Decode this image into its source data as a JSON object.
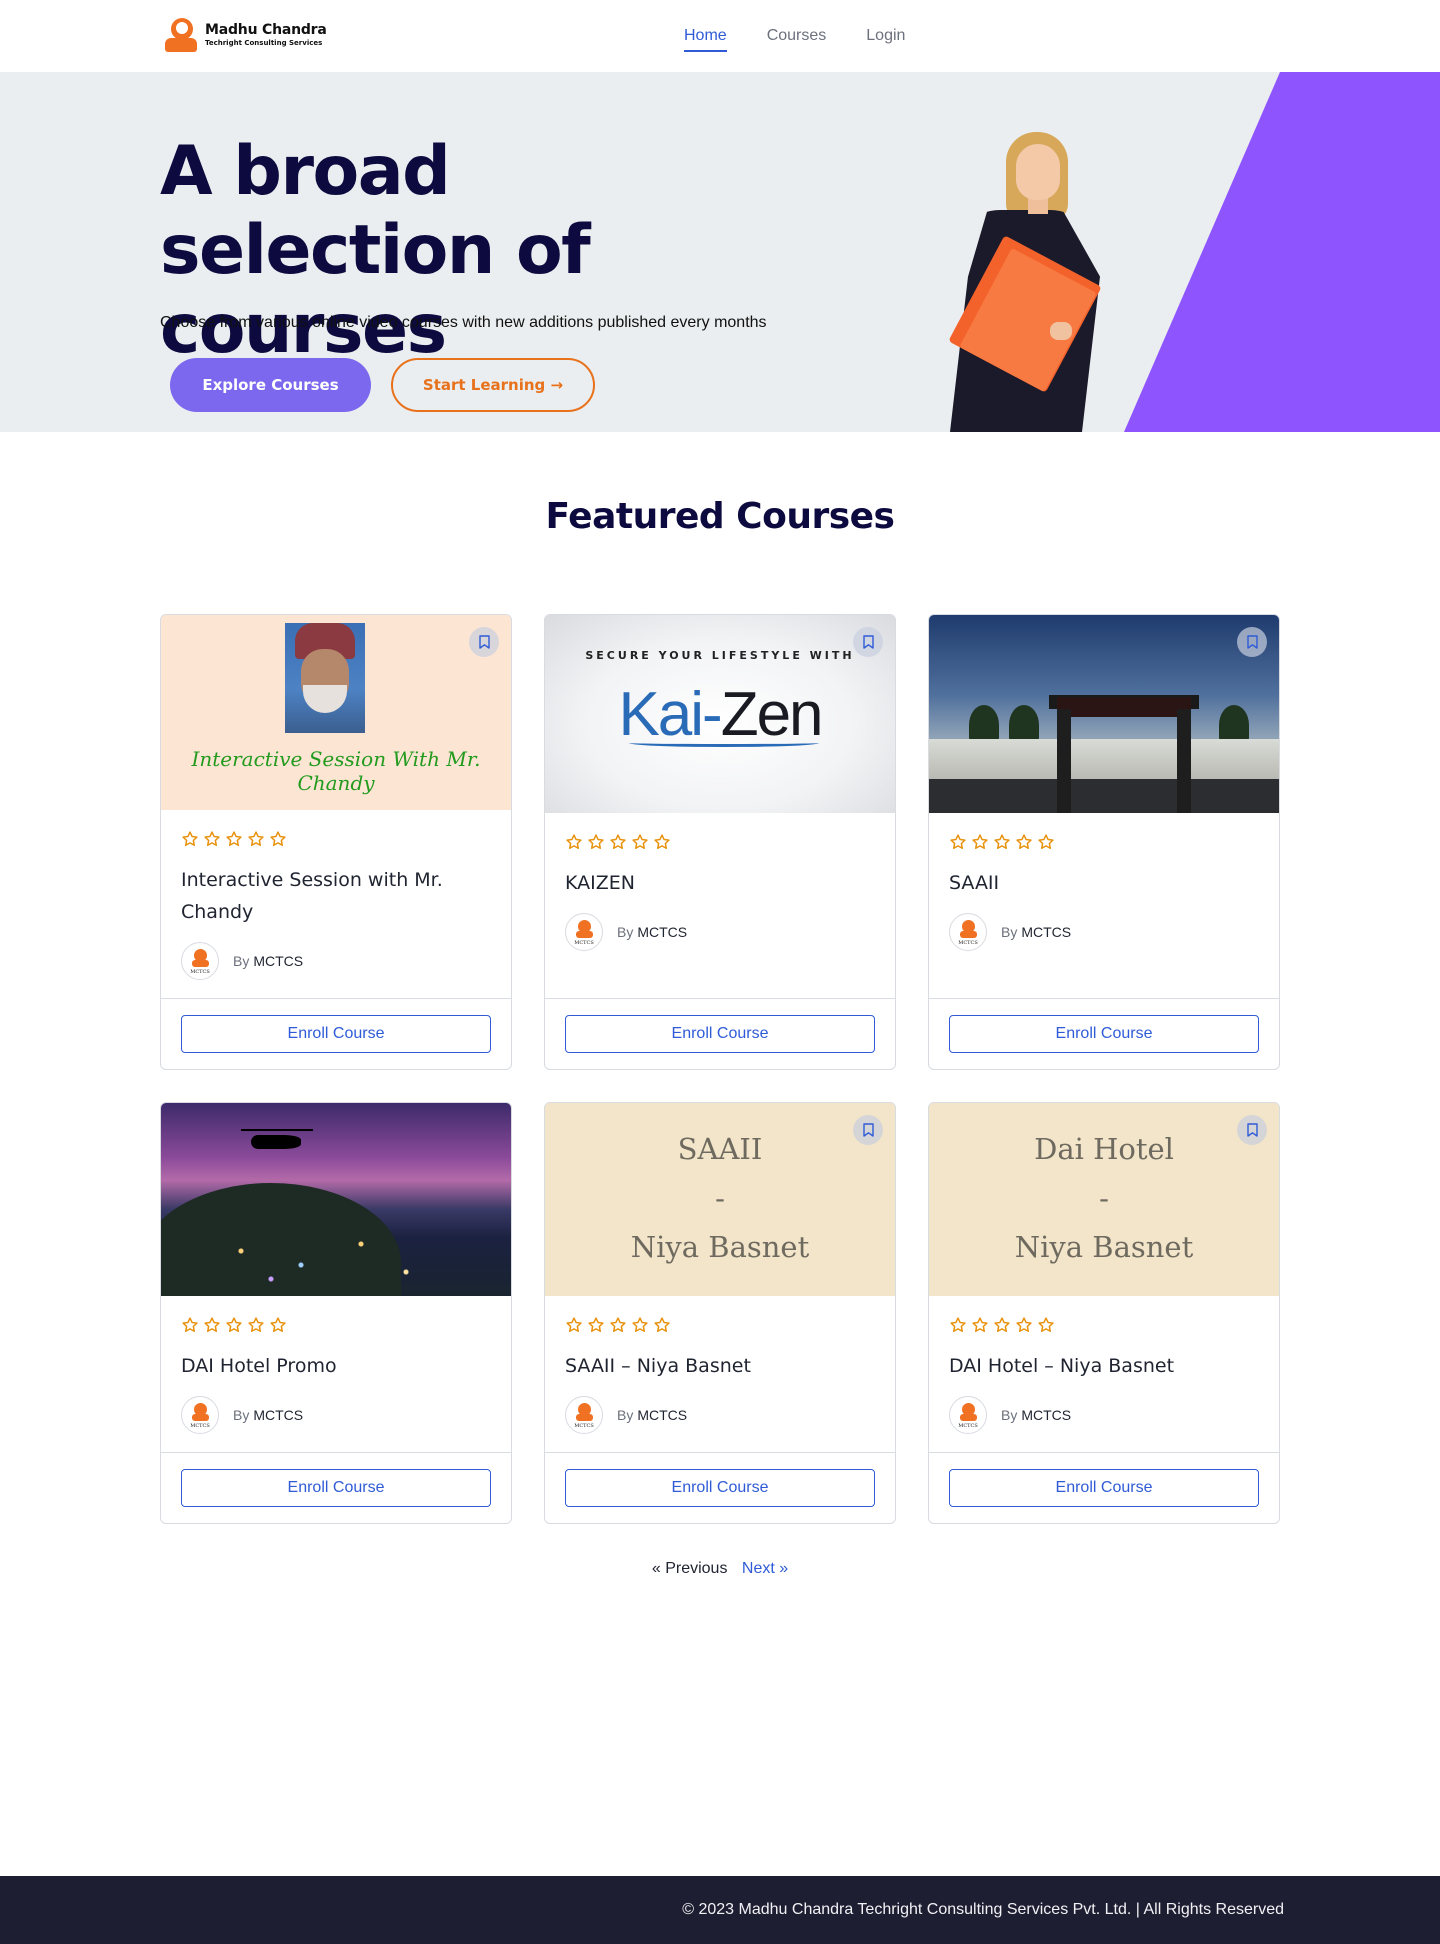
{
  "header": {
    "logo_title": "Madhu Chandra",
    "logo_subtitle": "Techright Consulting Services",
    "nav": [
      "Home",
      "Courses",
      "Login"
    ],
    "active_nav": "Home"
  },
  "hero": {
    "title": "A broad selection of courses",
    "subtitle": "Choose from various online video courses with new additions published every months",
    "explore_label": "Explore Courses",
    "start_label": "Start Learning →",
    "accent_purple": "#8e55ff",
    "button_purple": "#7b68ee",
    "orange": "#e8721c"
  },
  "section": {
    "title": "Featured Courses"
  },
  "courses": [
    {
      "title": "Interactive Session with Mr. Chandy",
      "by": "By",
      "author": "MCTCS",
      "enroll": "Enroll Course",
      "rating": 0,
      "thumb_caption": "Interactive Session With Mr. Chandy"
    },
    {
      "title": "KAIZEN",
      "by": "By",
      "author": "MCTCS",
      "enroll": "Enroll Course",
      "rating": 0,
      "thumb_top": "SECURE YOUR LIFESTYLE WITH",
      "thumb_brand_a": "Kai-",
      "thumb_brand_b": "Zen"
    },
    {
      "title": "SAAII",
      "by": "By",
      "author": "MCTCS",
      "enroll": "Enroll Course",
      "rating": 0
    },
    {
      "title": "DAI Hotel Promo",
      "by": "By",
      "author": "MCTCS",
      "enroll": "Enroll Course",
      "rating": 0
    },
    {
      "title": "SAAII – Niya Basnet",
      "by": "By",
      "author": "MCTCS",
      "enroll": "Enroll Course",
      "rating": 0,
      "thumb_lines": [
        "SAAII",
        "-",
        "Niya Basnet"
      ]
    },
    {
      "title": "DAI Hotel – Niya Basnet",
      "by": "By",
      "author": "MCTCS",
      "enroll": "Enroll Course",
      "rating": 0,
      "thumb_lines": [
        "Dai Hotel",
        "-",
        "Niya Basnet"
      ]
    }
  ],
  "avatar_text": "MCTCS",
  "pagination": {
    "prev": "«  Previous",
    "next": "Next  »"
  },
  "footer": {
    "text": "© 2023 Madhu Chandra Techright Consulting Services Pvt. Ltd. | All Rights Reserved"
  },
  "colors": {
    "link_blue": "#2f5bd7",
    "star_orange": "#e8920e",
    "navy": "#0c0a3e",
    "footer_bg": "#1e1e32"
  }
}
